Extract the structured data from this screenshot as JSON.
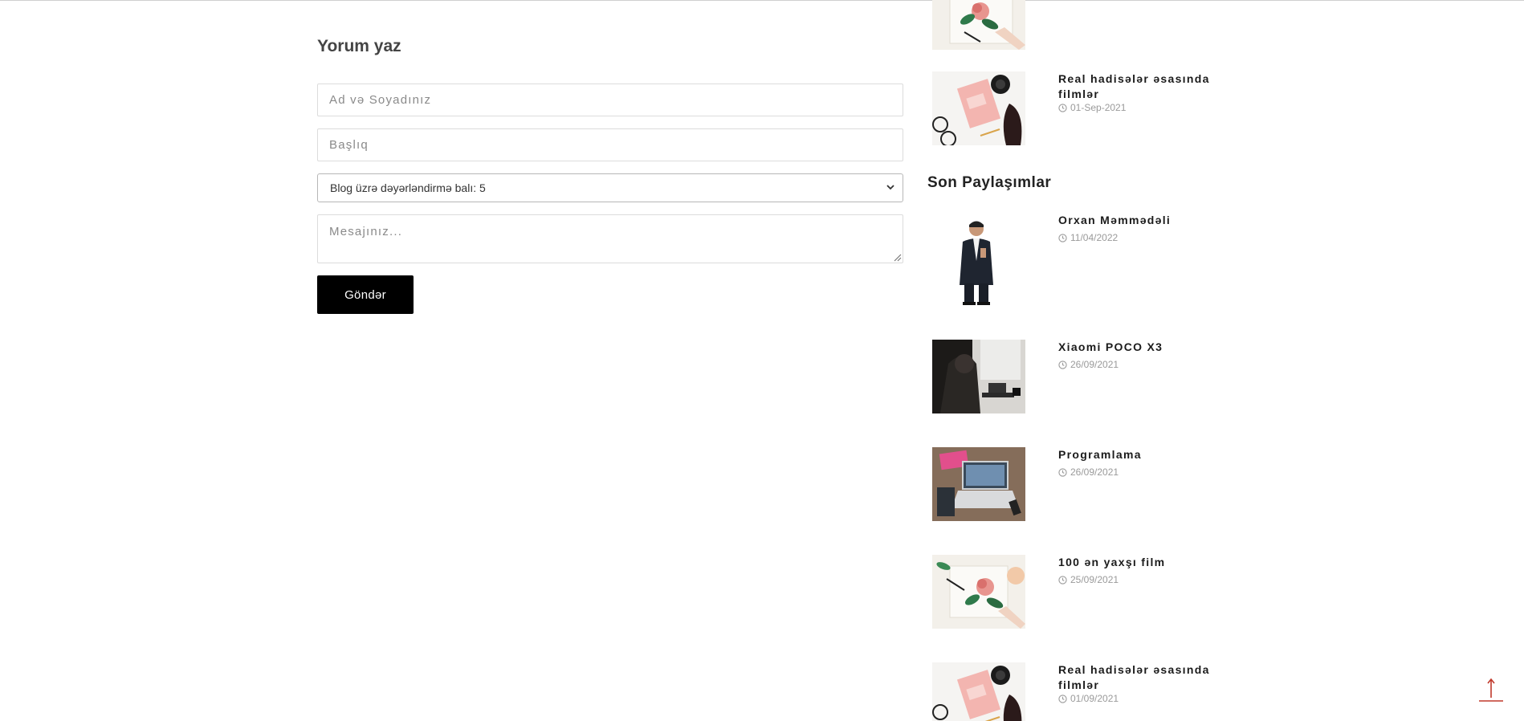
{
  "comment_form": {
    "title": "Yorum yaz",
    "name_placeholder": "Ad və Soyadınız",
    "subject_placeholder": "Başlıq",
    "rating_selected": "Blog üzrə dəyərləndirmə balı: 5",
    "message_placeholder": "Mesajınız...",
    "submit_label": "Göndər"
  },
  "sidebar": {
    "top_posts": [
      {
        "title": "",
        "date": "",
        "thumb": "flower-notebook-image"
      },
      {
        "title": "Real hadisələr əsasında filmlər",
        "date": "01-Sep-2021",
        "thumb": "little-black-book-image"
      }
    ],
    "recent_title": "Son Paylaşımlar",
    "recent_posts": [
      {
        "title": "Orxan Məmmədəli",
        "date": "11/04/2022",
        "thumb": "man-in-suit-image"
      },
      {
        "title": "Xiaomi POCO X3",
        "date": "26/09/2021",
        "thumb": "person-at-laptop-image"
      },
      {
        "title": "Programlama",
        "date": "26/09/2021",
        "thumb": "laptop-desk-image"
      },
      {
        "title": "100 ən yaxşı film",
        "date": "25/09/2021",
        "thumb": "flower-notebook-image"
      },
      {
        "title": "Real hadisələr əsasında filmlər",
        "date": "01/09/2021",
        "thumb": "little-black-book-image"
      }
    ]
  },
  "scroll_top_icon": "arrow-up-icon",
  "colors": {
    "button_bg": "#000000",
    "arrow": "#c0392b",
    "date": "#9a9a9a"
  }
}
